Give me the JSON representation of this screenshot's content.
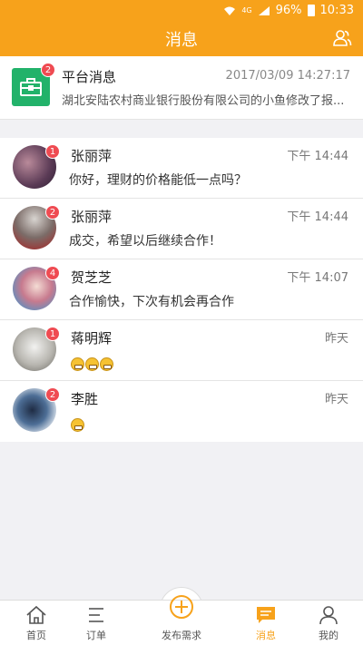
{
  "statusbar": {
    "network": "4G",
    "battery": "96%",
    "time": "10:33"
  },
  "header": {
    "title": "消息",
    "contacts_icon": "contacts-icon"
  },
  "platform": {
    "name": "平台消息",
    "badge": "2",
    "time": "2017/03/09 14:27:17",
    "preview": "湖北安陆农村商业银行股份有限公司的小鱼修改了报...",
    "icon": "briefcase-icon",
    "color": "#22b26a"
  },
  "conversations": [
    {
      "name": "张丽萍",
      "time": "下午 14:44",
      "badge": "1",
      "message": "你好，理财的价格能低一点吗？"
    },
    {
      "name": "张丽萍",
      "time": "下午 14:44",
      "badge": "2",
      "message": "成交，希望以后继续合作！"
    },
    {
      "name": "贺芝芝",
      "time": "下午 14:07",
      "badge": "4",
      "message": "合作愉快，下次有机会再合作"
    },
    {
      "name": "蒋明辉",
      "time": "昨天",
      "badge": "1",
      "message": "",
      "emoji_count": 3
    },
    {
      "name": "李胜",
      "time": "昨天",
      "badge": "2",
      "message": "",
      "emoji_count": 1
    }
  ],
  "tabs": [
    {
      "label": "首页",
      "icon": "home-icon"
    },
    {
      "label": "订单",
      "icon": "list-icon"
    },
    {
      "label": "发布需求",
      "icon": "plus-circle-icon"
    },
    {
      "label": "消息",
      "icon": "message-icon",
      "active": true
    },
    {
      "label": "我的",
      "icon": "person-icon"
    }
  ],
  "colors": {
    "accent": "#f7a21b",
    "badge": "#ef4b52",
    "platform_icon": "#22b26a"
  }
}
